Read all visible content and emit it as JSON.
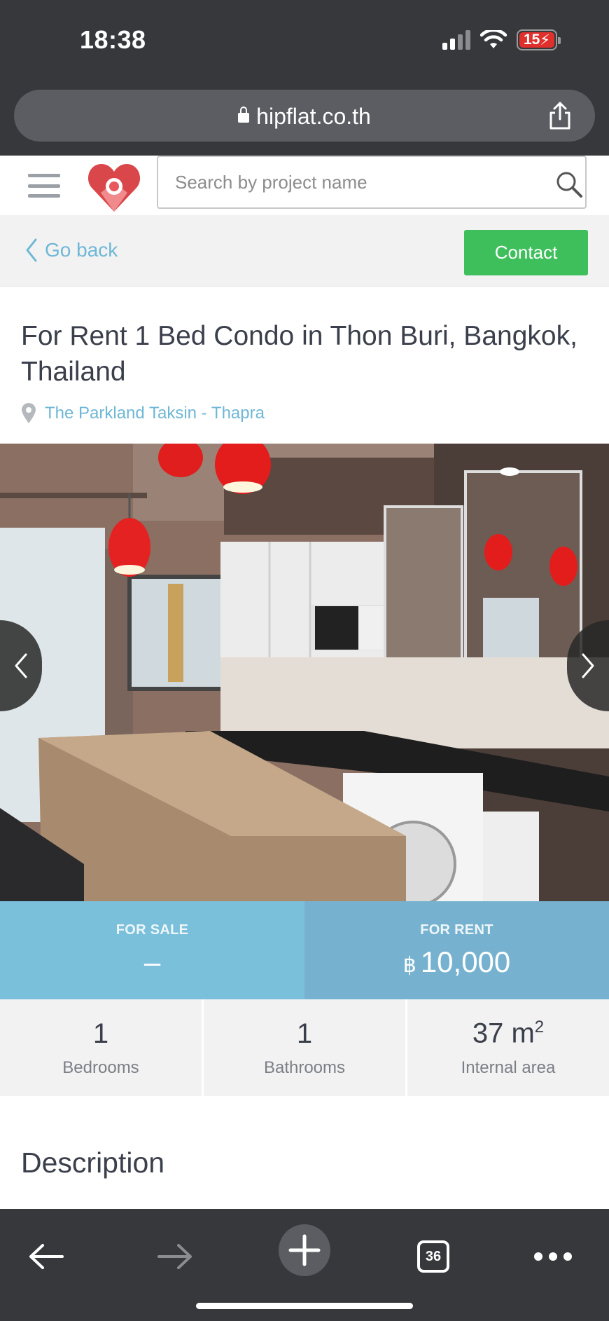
{
  "status_bar": {
    "time": "18:38",
    "battery": "15"
  },
  "browser": {
    "url": "hipflat.co.th"
  },
  "header": {
    "search_placeholder": "Search by project name"
  },
  "nav": {
    "back_label": "Go back",
    "contact_label": "Contact"
  },
  "listing": {
    "title": "For Rent 1 Bed Condo in Thon Buri, Bangkok, Thailand",
    "location": "The Parkland Taksin - Thapra"
  },
  "prices": {
    "sale_label": "FOR SALE",
    "sale_value": "–",
    "rent_label": "FOR RENT",
    "rent_currency": "฿",
    "rent_value": "10,000"
  },
  "stats": [
    {
      "value": "1",
      "label": "Bedrooms"
    },
    {
      "value": "1",
      "label": "Bathrooms"
    },
    {
      "value": "37",
      "unit": "m",
      "unit_sup": "2",
      "label": "Internal area"
    }
  ],
  "description_heading": "Description",
  "toolbar": {
    "tabs_count": "36"
  },
  "colors": {
    "contact_green": "#3ebf5b",
    "link_blue": "#6fb7d6",
    "sale_blue": "#7ac0da",
    "rent_blue": "#76b2cf"
  }
}
